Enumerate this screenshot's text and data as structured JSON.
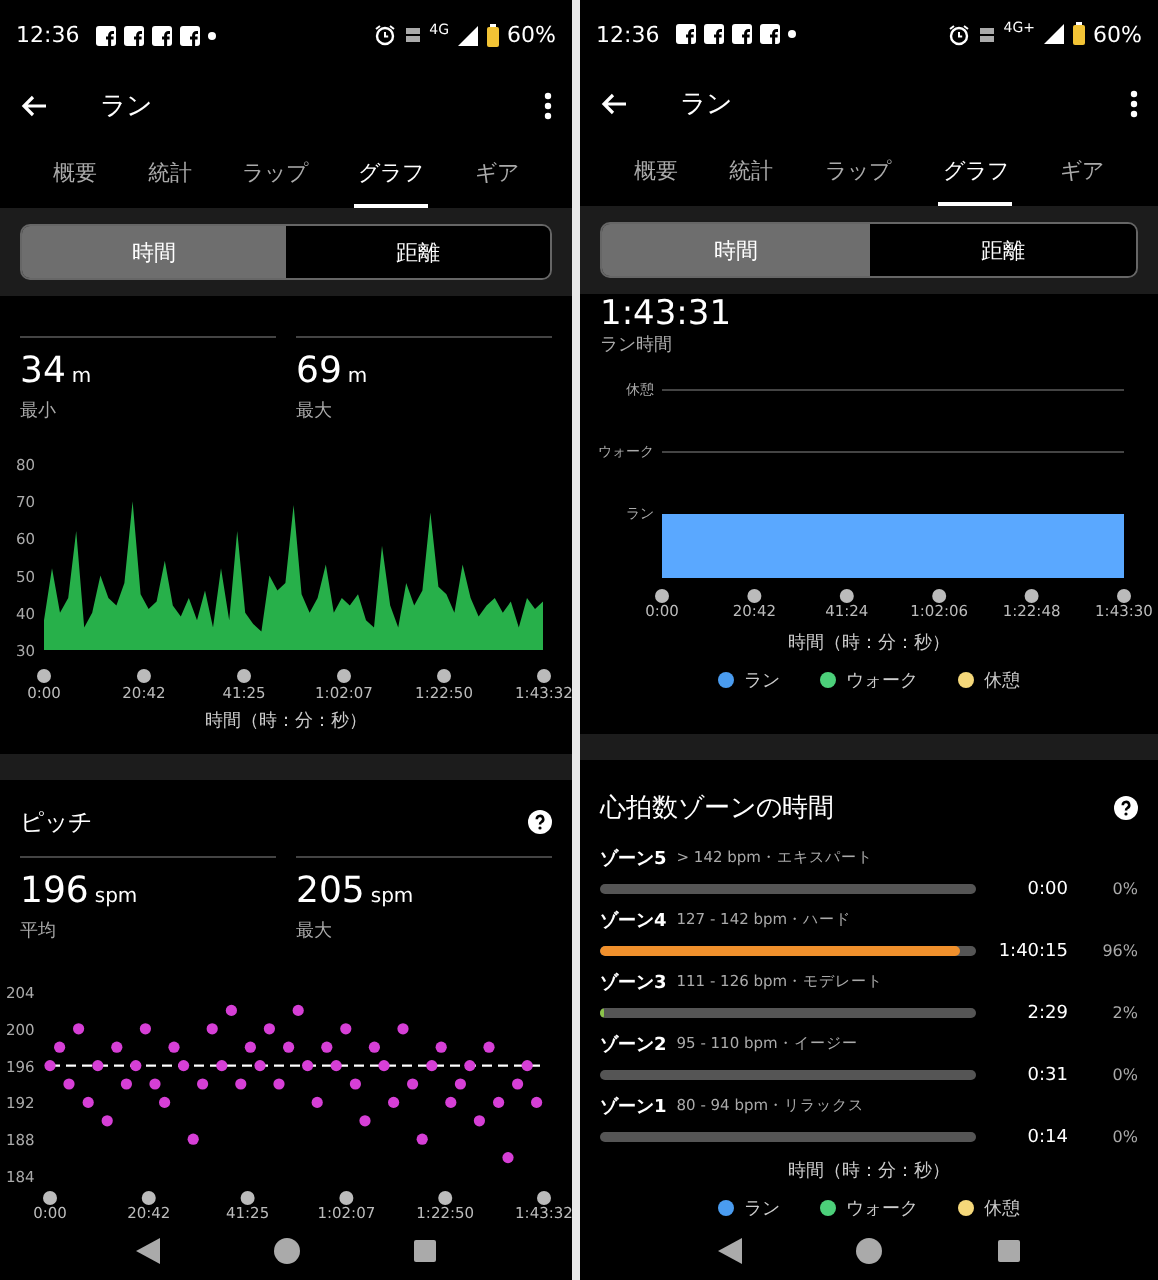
{
  "phones": [
    {
      "status_bar": {
        "time": "12:36",
        "network": "4G",
        "battery": "60%"
      },
      "app_bar": {
        "title": "ラン"
      },
      "tabs": [
        {
          "label": "概要",
          "selected": false
        },
        {
          "label": "統計",
          "selected": false
        },
        {
          "label": "ラップ",
          "selected": false
        },
        {
          "label": "グラフ",
          "selected": true
        },
        {
          "label": "ギア",
          "selected": false
        }
      ],
      "segments": [
        {
          "label": "時間",
          "selected": true
        },
        {
          "label": "距離",
          "selected": false
        }
      ],
      "sections": [
        {
          "kind": "stats_chart",
          "stats": [
            {
              "value": "34",
              "unit": "m",
              "label": "最小"
            },
            {
              "value": "69",
              "unit": "m",
              "label": "最大"
            }
          ],
          "xlabel": "時間（時：分：秒）",
          "chart_data": {
            "type": "area",
            "ylim": [
              30,
              80
            ],
            "yticks": [
              30,
              40,
              50,
              60,
              70,
              80
            ],
            "xlim": [
              0,
              6212
            ],
            "xticks": [
              {
                "value": 0,
                "label": "0:00"
              },
              {
                "value": 1242,
                "label": "20:42"
              },
              {
                "value": 2485,
                "label": "41:25"
              },
              {
                "value": 3727,
                "label": "1:02:07"
              },
              {
                "value": 4970,
                "label": "1:22:50"
              },
              {
                "value": 6212,
                "label": "1:43:32"
              }
            ],
            "x": [
              0,
              100,
              200,
              300,
              400,
              500,
              600,
              700,
              800,
              900,
              1000,
              1100,
              1200,
              1300,
              1400,
              1500,
              1600,
              1700,
              1800,
              1900,
              2000,
              2100,
              2200,
              2300,
              2400,
              2500,
              2600,
              2700,
              2800,
              2900,
              3000,
              3100,
              3200,
              3300,
              3400,
              3500,
              3600,
              3700,
              3800,
              3900,
              4000,
              4100,
              4200,
              4300,
              4400,
              4500,
              4600,
              4700,
              4800,
              4900,
              5000,
              5100,
              5200,
              5300,
              5400,
              5500,
              5600,
              5700,
              5800,
              5900,
              6000,
              6100,
              6200
            ],
            "series": [
              {
                "color": "#27b04a",
                "values": [
                  38,
                  52,
                  40,
                  44,
                  62,
                  36,
                  40,
                  50,
                  44,
                  42,
                  48,
                  70,
                  45,
                  41,
                  43,
                  54,
                  42,
                  39,
                  44,
                  38,
                  46,
                  36,
                  52,
                  38,
                  62,
                  40,
                  37,
                  35,
                  50,
                  46,
                  48,
                  69,
                  45,
                  40,
                  44,
                  53,
                  40,
                  44,
                  42,
                  45,
                  38,
                  36,
                  58,
                  42,
                  36,
                  48,
                  42,
                  46,
                  67,
                  47,
                  45,
                  40,
                  53,
                  44,
                  39,
                  42,
                  44,
                  40,
                  43,
                  36,
                  44,
                  41,
                  43
                ]
              }
            ]
          }
        },
        {
          "kind": "stats_chart",
          "title": "ピッチ",
          "help": true,
          "stats": [
            {
              "value": "196",
              "unit": "spm",
              "label": "平均"
            },
            {
              "value": "205",
              "unit": "spm",
              "label": "最大"
            }
          ],
          "chart_data": {
            "type": "scatter",
            "ylim": [
              184,
              204
            ],
            "yticks": [
              184,
              188,
              192,
              196,
              200,
              204
            ],
            "xlim": [
              0,
              6212
            ],
            "xticks": [
              {
                "value": 0,
                "label": "0:00"
              },
              {
                "value": 1242,
                "label": "20:42"
              },
              {
                "value": 2485,
                "label": "41:25"
              },
              {
                "value": 3727,
                "label": "1:02:07"
              },
              {
                "value": 4970,
                "label": "1:22:50"
              },
              {
                "value": 6212,
                "label": "1:43:32"
              }
            ],
            "x": [
              0,
              120,
              240,
              360,
              480,
              600,
              720,
              840,
              960,
              1080,
              1200,
              1320,
              1440,
              1560,
              1680,
              1800,
              1920,
              2040,
              2160,
              2280,
              2400,
              2520,
              2640,
              2760,
              2880,
              3000,
              3120,
              3240,
              3360,
              3480,
              3600,
              3720,
              3840,
              3960,
              4080,
              4200,
              4320,
              4440,
              4560,
              4680,
              4800,
              4920,
              5040,
              5160,
              5280,
              5400,
              5520,
              5640,
              5760,
              5880,
              6000,
              6120
            ],
            "series": [
              {
                "color": "#d63fd6",
                "values": [
                  196,
                  198,
                  194,
                  200,
                  192,
                  196,
                  190,
                  198,
                  194,
                  196,
                  200,
                  194,
                  192,
                  198,
                  196,
                  188,
                  194,
                  200,
                  196,
                  202,
                  194,
                  198,
                  196,
                  200,
                  194,
                  198,
                  202,
                  196,
                  192,
                  198,
                  196,
                  200,
                  194,
                  190,
                  198,
                  196,
                  192,
                  200,
                  194,
                  188,
                  196,
                  198,
                  192,
                  194,
                  196,
                  190,
                  198,
                  192,
                  186,
                  194,
                  196,
                  192
                ]
              }
            ]
          }
        }
      ]
    },
    {
      "status_bar": {
        "time": "12:36",
        "network": "4G+",
        "battery": "60%"
      },
      "app_bar": {
        "title": "ラン"
      },
      "tabs": [
        {
          "label": "概要",
          "selected": false
        },
        {
          "label": "統計",
          "selected": false
        },
        {
          "label": "ラップ",
          "selected": false
        },
        {
          "label": "グラフ",
          "selected": true
        },
        {
          "label": "ギア",
          "selected": false
        }
      ],
      "segments": [
        {
          "label": "時間",
          "selected": true
        },
        {
          "label": "距離",
          "selected": false
        }
      ],
      "sections": [
        {
          "kind": "timeline",
          "value": "1:43:31",
          "label": "ラン時間",
          "xlabel": "時間（時：分：秒）",
          "chart_data": {
            "type": "bar",
            "orientation": "horizontal",
            "categories": [
              "休憩",
              "ウォーク",
              "ラン"
            ],
            "xlim": [
              0,
              6210
            ],
            "xticks": [
              {
                "value": 0,
                "label": "0:00"
              },
              {
                "value": 1242,
                "label": "20:42"
              },
              {
                "value": 2484,
                "label": "41:24"
              },
              {
                "value": 3726,
                "label": "1:02:06"
              },
              {
                "value": 4968,
                "label": "1:22:48"
              },
              {
                "value": 6210,
                "label": "1:43:30"
              }
            ],
            "series": [
              {
                "color": "#5aa8ff",
                "values": [
                  null,
                  null,
                  6210
                ]
              }
            ]
          },
          "legend": [
            {
              "label": "ラン",
              "color": "#4a9cf0"
            },
            {
              "label": "ウォーク",
              "color": "#4cd07a"
            },
            {
              "label": "休憩",
              "color": "#f5d87a"
            }
          ]
        },
        {
          "kind": "zones",
          "title": "心拍数ゾーンの時間",
          "help": true,
          "zones": [
            {
              "name": "ゾーン5",
              "range": "> 142 bpm・エキスパート",
              "time": "0:00",
              "percent": "0%"
            },
            {
              "name": "ゾーン4",
              "range": "127 - 142 bpm・ハード",
              "level": 0.96,
              "color": "#f0902c",
              "time": "1:40:15",
              "percent": "96%"
            },
            {
              "name": "ゾーン3",
              "range": "111 - 126 bpm・モデレート",
              "level": 0.012,
              "color": "#8bc34a",
              "time": "2:29",
              "percent": "2%"
            },
            {
              "name": "ゾーン2",
              "range": "95 - 110 bpm・イージー",
              "time": "0:31",
              "percent": "0%"
            },
            {
              "name": "ゾーン1",
              "range": "80 - 94 bpm・リラックス",
              "time": "0:14",
              "percent": "0%"
            }
          ],
          "xlabel": "時間（時：分：秒）",
          "legend": [
            {
              "label": "ラン",
              "color": "#4a9cf0"
            },
            {
              "label": "ウォーク",
              "color": "#4cd07a"
            },
            {
              "label": "休憩",
              "color": "#f5d87a"
            }
          ]
        }
      ]
    }
  ]
}
